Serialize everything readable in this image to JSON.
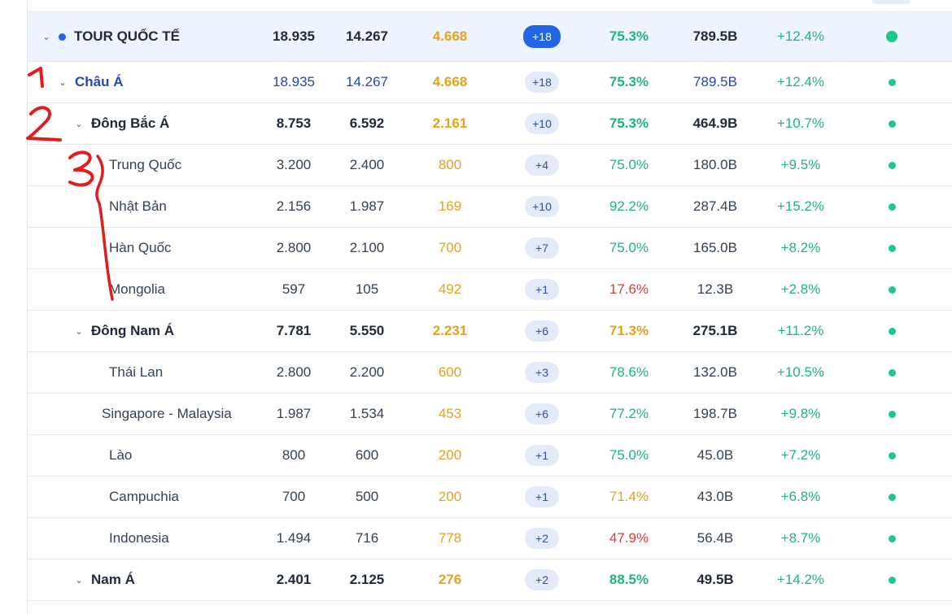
{
  "rows": [
    {
      "level": 0,
      "name": "TOUR QUỐC TẾ",
      "c1": "18.935",
      "c2": "14.267",
      "c3": "4.668",
      "badge": "+18",
      "pct": "75.3%",
      "pct_color": "green",
      "rev": "789.5B",
      "growth": "+12.4%"
    },
    {
      "level": 1,
      "name": "Châu Á",
      "c1": "18.935",
      "c2": "14.267",
      "c3": "4.668",
      "badge": "+18",
      "pct": "75.3%",
      "pct_color": "green",
      "rev": "789.5B",
      "growth": "+12.4%"
    },
    {
      "level": 2,
      "name": "Đông Bắc Á",
      "c1": "8.753",
      "c2": "6.592",
      "c3": "2.161",
      "badge": "+10",
      "pct": "75.3%",
      "pct_color": "green",
      "rev": "464.9B",
      "growth": "+10.7%"
    },
    {
      "level": 3,
      "name": "Trung Quốc",
      "c1": "3.200",
      "c2": "2.400",
      "c3": "800",
      "badge": "+4",
      "pct": "75.0%",
      "pct_color": "green",
      "rev": "180.0B",
      "growth": "+9.5%"
    },
    {
      "level": 3,
      "name": "Nhật Bản",
      "c1": "2.156",
      "c2": "1.987",
      "c3": "169",
      "badge": "+10",
      "pct": "92.2%",
      "pct_color": "green",
      "rev": "287.4B",
      "growth": "+15.2%"
    },
    {
      "level": 3,
      "name": "Hàn Quốc",
      "c1": "2.800",
      "c2": "2.100",
      "c3": "700",
      "badge": "+7",
      "pct": "75.0%",
      "pct_color": "green",
      "rev": "165.0B",
      "growth": "+8.2%"
    },
    {
      "level": 3,
      "name": "Mongolia",
      "c1": "597",
      "c2": "105",
      "c3": "492",
      "badge": "+1",
      "pct": "17.6%",
      "pct_color": "red",
      "rev": "12.3B",
      "growth": "+2.8%"
    },
    {
      "level": 2,
      "name": "Đông Nam Á",
      "c1": "7.781",
      "c2": "5.550",
      "c3": "2.231",
      "badge": "+6",
      "pct": "71.3%",
      "pct_color": "orange",
      "rev": "275.1B",
      "growth": "+11.2%"
    },
    {
      "level": 3,
      "name": "Thái Lan",
      "c1": "2.800",
      "c2": "2.200",
      "c3": "600",
      "badge": "+3",
      "pct": "78.6%",
      "pct_color": "green",
      "rev": "132.0B",
      "growth": "+10.5%"
    },
    {
      "level": 3,
      "name": "Singapore - Malaysia",
      "c1": "1.987",
      "c2": "1.534",
      "c3": "453",
      "badge": "+6",
      "pct": "77.2%",
      "pct_color": "green",
      "rev": "198.7B",
      "growth": "+9.8%"
    },
    {
      "level": 3,
      "name": "Lào",
      "c1": "800",
      "c2": "600",
      "c3": "200",
      "badge": "+1",
      "pct": "75.0%",
      "pct_color": "green",
      "rev": "45.0B",
      "growth": "+7.2%"
    },
    {
      "level": 3,
      "name": "Campuchia",
      "c1": "700",
      "c2": "500",
      "c3": "200",
      "badge": "+1",
      "pct": "71.4%",
      "pct_color": "orange",
      "rev": "43.0B",
      "growth": "+6.8%"
    },
    {
      "level": 3,
      "name": "Indonesia",
      "c1": "1.494",
      "c2": "716",
      "c3": "778",
      "badge": "+2",
      "pct": "47.9%",
      "pct_color": "red",
      "rev": "56.4B",
      "growth": "+8.7%"
    },
    {
      "level": 2,
      "name": "Nam Á",
      "c1": "2.401",
      "c2": "2.125",
      "c3": "276",
      "badge": "+2",
      "pct": "88.5%",
      "pct_color": "green",
      "rev": "49.5B",
      "growth": "+14.2%"
    }
  ],
  "colors": {
    "accent": "#2266e3",
    "positive": "#1fb57a",
    "warning": "#e5a21a",
    "negative": "#dc3d3d",
    "status_dot": "#1ec88a",
    "annotation": "#e11d1d"
  },
  "annotations": [
    "1",
    "2",
    "3"
  ]
}
